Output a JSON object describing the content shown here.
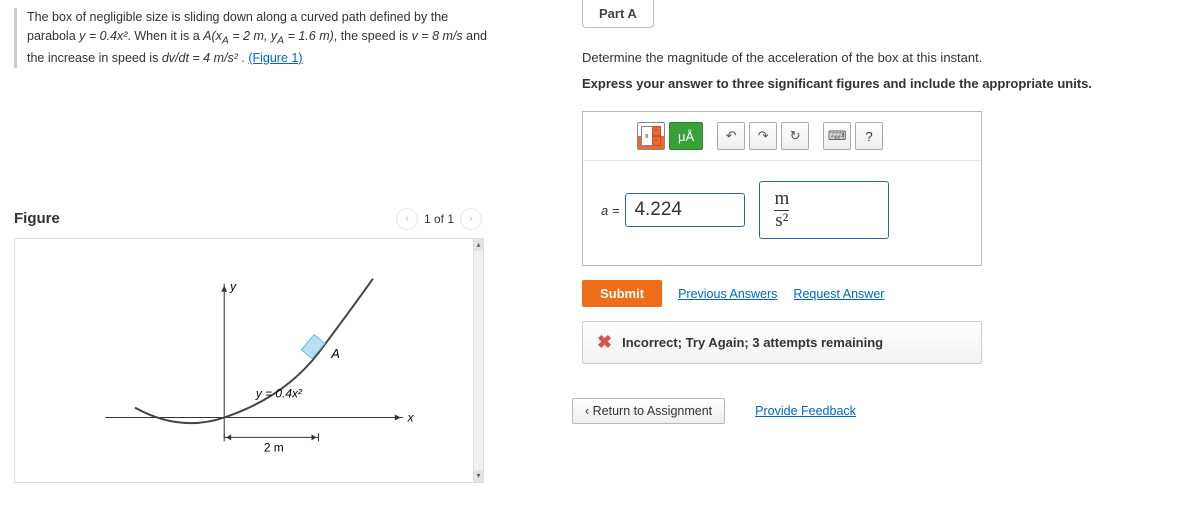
{
  "problem": {
    "line1_a": "The box of negligible size is sliding down along a curved path defined by the parabola ",
    "eq1": "y = 0.4x²",
    "line1_b": ". When it is a ",
    "pt": "A(x",
    "subA1": "A",
    "eqxa": " = 2 m, y",
    "subA2": "A",
    "eqya": " = 1.6 m)",
    "line1_c": ", the speed is ",
    "v": "v = 8  m/s",
    "line1_d": " and the increase in speed is ",
    "dvdt": "dv/dt = 4  m/s²",
    "line1_e": " . ",
    "figlink": "(Figure 1)"
  },
  "figure": {
    "title": "Figure",
    "pager": "1 of 1",
    "eqlabel": "y = 0.4x²",
    "xlabel": "x",
    "ylabel": "y",
    "ptlabel": "A",
    "dim": "2 m"
  },
  "part": {
    "header": "Part A",
    "q1": "Determine the magnitude of the acceleration of the box at this instant.",
    "q2": "Express your answer to three significant figures and include the appropriate units."
  },
  "toolbar": {
    "mua": "μÅ",
    "undo": "↶",
    "redo": "↷",
    "reset": "↻",
    "kbd": "⌨",
    "help": "?"
  },
  "answer": {
    "lhs": "a =",
    "value": "4.224",
    "unit_num": "m",
    "unit_den": "s²"
  },
  "submit": {
    "label": "Submit",
    "prev": "Previous Answers",
    "req": "Request Answer"
  },
  "feedback": {
    "msg": "Incorrect; Try Again; 3 attempts remaining"
  },
  "footer": {
    "return": "Return to Assignment",
    "feedback": "Provide Feedback"
  }
}
